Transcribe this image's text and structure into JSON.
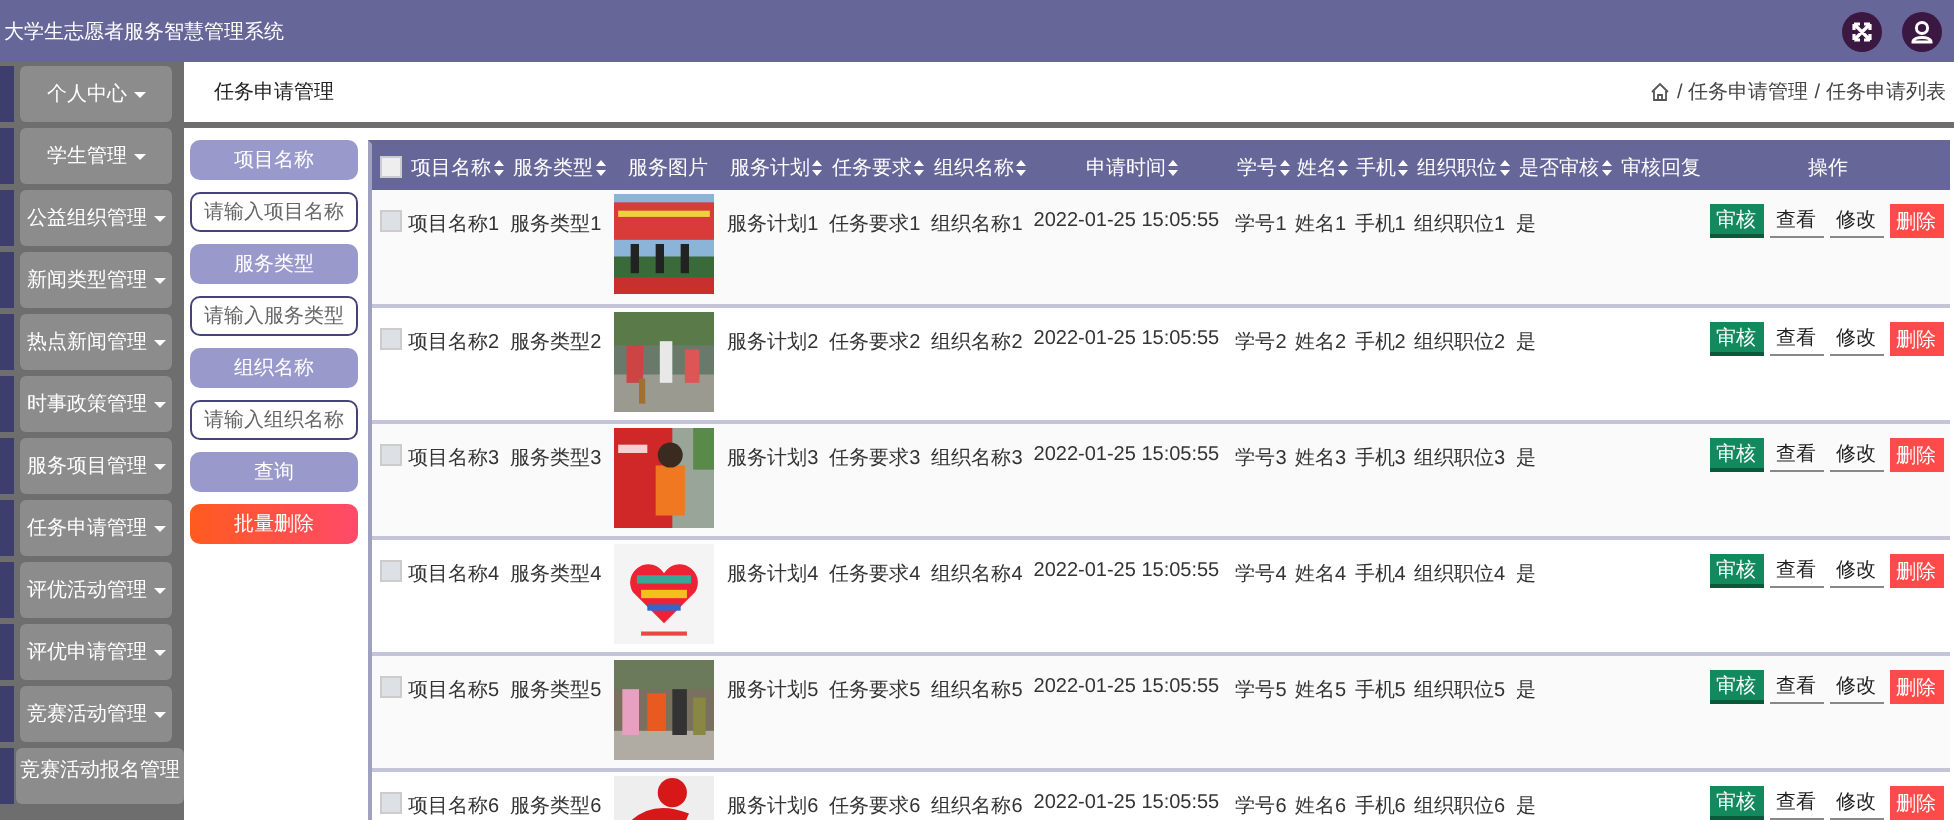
{
  "header": {
    "title": "大学生志愿者服务智慧管理系统"
  },
  "sidebar": {
    "items": [
      {
        "label": "个人中心",
        "caret": true
      },
      {
        "label": "学生管理",
        "caret": true
      },
      {
        "label": "公益组织管理",
        "caret": true
      },
      {
        "label": "新闻类型管理",
        "caret": true
      },
      {
        "label": "热点新闻管理",
        "caret": true
      },
      {
        "label": "时事政策管理",
        "caret": true
      },
      {
        "label": "服务项目管理",
        "caret": true
      },
      {
        "label": "任务申请管理",
        "caret": true
      },
      {
        "label": "评优活动管理",
        "caret": true
      },
      {
        "label": "评优申请管理",
        "caret": true
      },
      {
        "label": "竞赛活动管理",
        "caret": true
      },
      {
        "label": "竞赛活动报名管理",
        "caret": false
      }
    ]
  },
  "page": {
    "title": "任务申请管理",
    "breadcrumb": [
      {
        "separator": "/",
        "label": "任务申请管理"
      },
      {
        "separator": "/",
        "label": "任务申请列表"
      }
    ]
  },
  "search": {
    "fields": [
      {
        "label": "项目名称",
        "placeholder": "请输入项目名称"
      },
      {
        "label": "服务类型",
        "placeholder": "请输入服务类型"
      },
      {
        "label": "组织名称",
        "placeholder": "请输入组织名称"
      }
    ],
    "query_button": "查询",
    "batch_delete_button": "批量删除"
  },
  "table": {
    "all_checked": false,
    "columns": [
      {
        "label": "项目名称",
        "sortable": true
      },
      {
        "label": "服务类型",
        "sortable": true
      },
      {
        "label": "服务图片",
        "sortable": false
      },
      {
        "label": "服务计划",
        "sortable": true
      },
      {
        "label": "任务要求",
        "sortable": true
      },
      {
        "label": "组织名称",
        "sortable": true
      },
      {
        "label": "申请时间",
        "sortable": true
      },
      {
        "label": "学号",
        "sortable": true
      },
      {
        "label": "姓名",
        "sortable": true
      },
      {
        "label": "手机",
        "sortable": true
      },
      {
        "label": "组织职位",
        "sortable": true
      },
      {
        "label": "是否审核",
        "sortable": true
      },
      {
        "label": "审核回复",
        "sortable": false
      },
      {
        "label": "操作",
        "sortable": false
      }
    ],
    "rows": [
      {
        "checked": false,
        "cells": [
          "项目名称1",
          "服务类型1",
          "",
          "服务计划1",
          "任务要求1",
          "组织名称1",
          "2022-01-25 15:05:55",
          "学号1",
          "姓名1",
          "手机1",
          "组织职位1",
          "是",
          ""
        ],
        "actions": [
          {
            "label": "审核",
            "kind": "audit"
          },
          {
            "label": "查看",
            "kind": "plain"
          },
          {
            "label": "修改",
            "kind": "plain"
          },
          {
            "label": "删除",
            "kind": "danger"
          }
        ]
      },
      {
        "checked": false,
        "cells": [
          "项目名称2",
          "服务类型2",
          "",
          "服务计划2",
          "任务要求2",
          "组织名称2",
          "2022-01-25 15:05:55",
          "学号2",
          "姓名2",
          "手机2",
          "组织职位2",
          "是",
          ""
        ],
        "actions": [
          {
            "label": "审核",
            "kind": "audit"
          },
          {
            "label": "查看",
            "kind": "plain"
          },
          {
            "label": "修改",
            "kind": "plain"
          },
          {
            "label": "删除",
            "kind": "danger"
          }
        ]
      },
      {
        "checked": false,
        "cells": [
          "项目名称3",
          "服务类型3",
          "",
          "服务计划3",
          "任务要求3",
          "组织名称3",
          "2022-01-25 15:05:55",
          "学号3",
          "姓名3",
          "手机3",
          "组织职位3",
          "是",
          ""
        ],
        "actions": [
          {
            "label": "审核",
            "kind": "audit"
          },
          {
            "label": "查看",
            "kind": "plain"
          },
          {
            "label": "修改",
            "kind": "plain"
          },
          {
            "label": "删除",
            "kind": "danger"
          }
        ]
      },
      {
        "checked": false,
        "cells": [
          "项目名称4",
          "服务类型4",
          "",
          "服务计划4",
          "任务要求4",
          "组织名称4",
          "2022-01-25 15:05:55",
          "学号4",
          "姓名4",
          "手机4",
          "组织职位4",
          "是",
          ""
        ],
        "actions": [
          {
            "label": "审核",
            "kind": "audit"
          },
          {
            "label": "查看",
            "kind": "plain"
          },
          {
            "label": "修改",
            "kind": "plain"
          },
          {
            "label": "删除",
            "kind": "danger"
          }
        ]
      },
      {
        "checked": false,
        "cells": [
          "项目名称5",
          "服务类型5",
          "",
          "服务计划5",
          "任务要求5",
          "组织名称5",
          "2022-01-25 15:05:55",
          "学号5",
          "姓名5",
          "手机5",
          "组织职位5",
          "是",
          ""
        ],
        "actions": [
          {
            "label": "审核",
            "kind": "audit"
          },
          {
            "label": "查看",
            "kind": "plain"
          },
          {
            "label": "修改",
            "kind": "plain"
          },
          {
            "label": "删除",
            "kind": "danger"
          }
        ]
      },
      {
        "checked": false,
        "cells": [
          "项目名称6",
          "服务类型6",
          "",
          "服务计划6",
          "任务要求6",
          "组织名称6",
          "2022-01-25 15:05:55",
          "学号6",
          "姓名6",
          "手机6",
          "组织职位6",
          "是",
          ""
        ],
        "actions": [
          {
            "label": "审核",
            "kind": "audit"
          },
          {
            "label": "查看",
            "kind": "plain"
          },
          {
            "label": "修改",
            "kind": "plain"
          },
          {
            "label": "删除",
            "kind": "danger"
          }
        ]
      }
    ]
  }
}
